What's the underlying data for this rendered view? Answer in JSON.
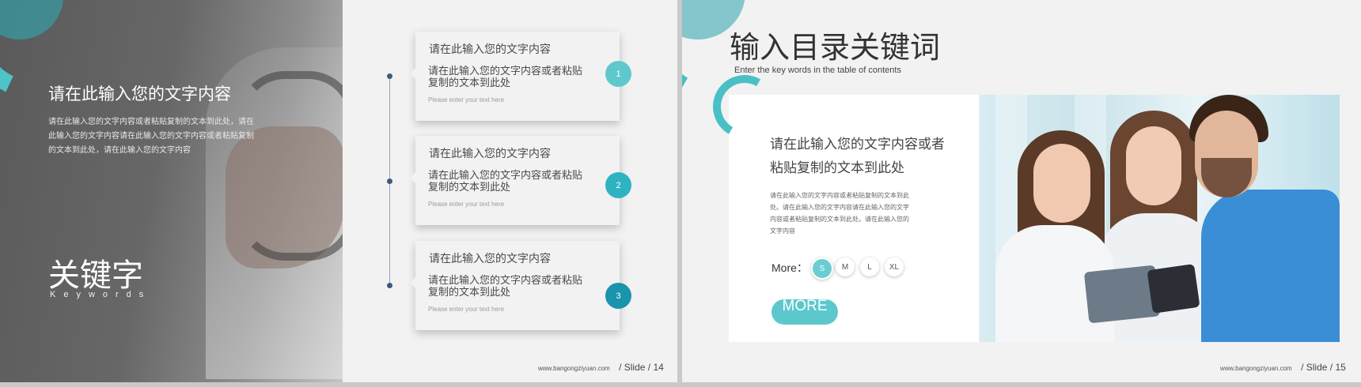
{
  "left_slide": {
    "heading": "请在此输入您的文字内容",
    "body": "请在此输入您的文字内容或者粘贴复制的文本到此处，请在此输入您的文字内容请在此输入您的文字内容或者粘贴复制的文本到此处，请在此输入您的文字内容",
    "keyword_big": "关键字",
    "keyword_small": "Keywords",
    "items": [
      {
        "title": "请在此输入您的文字内容",
        "desc": "请在此输入您的文字内容或者粘贴复制的文本到此处",
        "sub": "Please enter your text here",
        "number": "1"
      },
      {
        "title": "请在此输入您的文字内容",
        "desc": "请在此输入您的文字内容或者粘贴复制的文本到此处",
        "sub": "Please enter your text here",
        "number": "2"
      },
      {
        "title": "请在此输入您的文字内容",
        "desc": "请在此输入您的文字内容或者粘贴复制的文本到此处",
        "sub": "Please enter your text here",
        "number": "3"
      }
    ],
    "badge_colors": [
      "#5fc8cd",
      "#2fb3c0",
      "#1a93ad"
    ],
    "footer": {
      "url": "www.bangongziyuan.com",
      "slide_label": "/ Slide",
      "sep": "/",
      "page": "14"
    }
  },
  "right_slide": {
    "title": "输入目录关键词",
    "subtitle": "Enter the key words in the table of contents",
    "card_heading": "请在此输入您的文字内容或者粘贴复制的文本到此处",
    "card_body": "请在此输入您的文字内容或者粘贴复制的文本到此处。请在此输入您的文字内容请在此输入您的文字内容或者粘贴复制的文本到此处。请在此输入您的文字内容",
    "more_label": "More：",
    "sizes": [
      "S",
      "M",
      "L",
      "XL"
    ],
    "selected_size": "S",
    "more_button": "MORE",
    "footer": {
      "url": "www.bangongziyuan.com",
      "slide_label": "/ Slide",
      "sep": "/",
      "page": "15"
    }
  },
  "accent_color": "#4ec3c8"
}
